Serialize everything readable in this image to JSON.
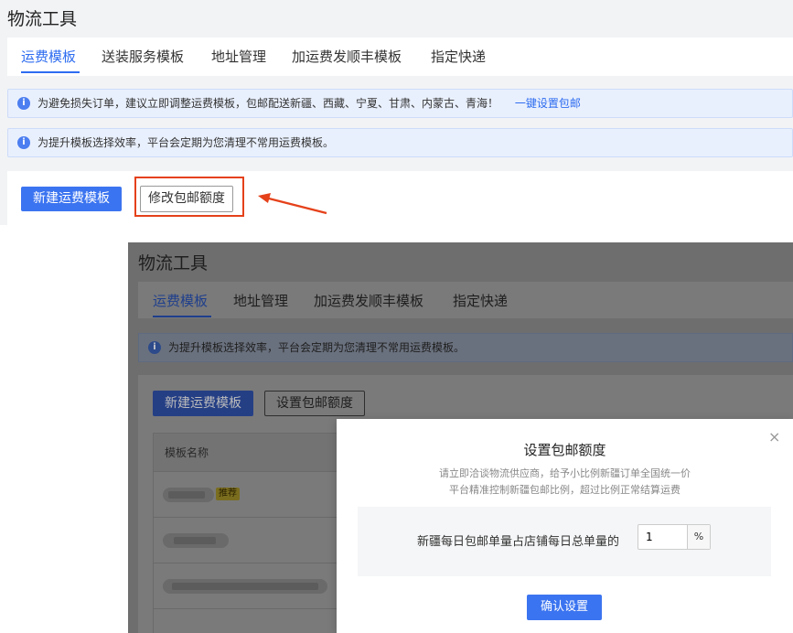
{
  "top": {
    "title": "物流工具",
    "tabs": [
      {
        "label": "运费模板",
        "active": true
      },
      {
        "label": "送装服务模板",
        "active": false
      },
      {
        "label": "地址管理",
        "active": false
      },
      {
        "label": "加运费发顺丰模板",
        "active": false
      },
      {
        "label": "指定快递",
        "active": false
      }
    ],
    "notices": [
      {
        "text": "为避免损失订单，建议立即调整运费模板，包邮配送新疆、西藏、宁夏、甘肃、内蒙古、青海！",
        "link": "一键设置包邮"
      },
      {
        "text": "为提升模板选择效率，平台会定期为您清理不常用运费模板。"
      }
    ],
    "new_template_button": "新建运费模板",
    "modify_free_shipping_button": "修改包邮额度"
  },
  "second": {
    "title": "物流工具",
    "tabs": [
      {
        "label": "运费模板",
        "active": true
      },
      {
        "label": "地址管理",
        "active": false
      },
      {
        "label": "加运费发顺丰模板",
        "active": false
      },
      {
        "label": "指定快递",
        "active": false
      }
    ],
    "notice": "为提升模板选择效率，平台会定期为您清理不常用运费模板。",
    "new_template_button": "新建运费模板",
    "set_free_shipping_button": "设置包邮额度",
    "table_header": "模板名称",
    "recommended_tag": "推荐"
  },
  "dialog": {
    "title": "设置包邮额度",
    "subtitle_line1": "请立即洽谈物流供应商，给予小比例新疆订单全国统一价",
    "subtitle_line2": "平台精准控制新疆包邮比例，超过比例正常结算运费",
    "field_label": "新疆每日包邮单量占店铺每日总单量的",
    "field_value": "1",
    "field_unit": "%",
    "confirm_button": "确认设置",
    "close_symbol": "×"
  },
  "colors": {
    "accent": "#3b74f0",
    "highlight": "#e5411a"
  }
}
